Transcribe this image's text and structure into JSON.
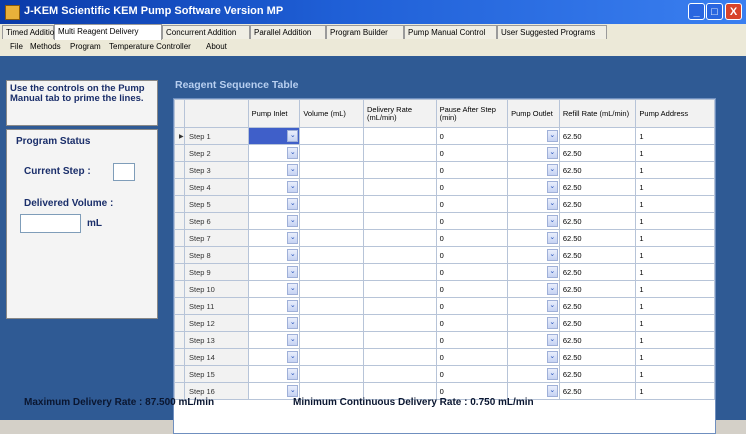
{
  "window": {
    "title": "J-KEM Scientific KEM Pump Software   Version MP"
  },
  "tabs": [
    {
      "label": "Timed Addition"
    },
    {
      "label": "Multi Reagent Delivery"
    },
    {
      "label": "Concurrent Addition"
    },
    {
      "label": "Parallel Addition"
    },
    {
      "label": "Program Builder"
    },
    {
      "label": "Pump Manual Control"
    },
    {
      "label": "User Suggested Programs"
    }
  ],
  "menu": [
    "File",
    "Methods",
    "Program",
    "Temperature Controller",
    "About"
  ],
  "note": "Use the controls on the Pump Manual tab to prime the lines.",
  "status": {
    "title": "Program Status",
    "current_step_label": "Current Step :",
    "current_step_value": "",
    "delivered_volume_label": "Delivered Volume :",
    "delivered_volume_value": "",
    "delivered_volume_unit": "mL"
  },
  "grid": {
    "title": "Reagent Sequence Table",
    "columns": [
      "",
      "",
      "Pump Inlet",
      "Volume (mL)",
      "Delivery Rate (mL/min)",
      "Pause After Step (min)",
      "Pump Outlet",
      "Refill Rate (mL/min)",
      "Pump Address"
    ],
    "rows": [
      {
        "step": "Step 1",
        "inlet": "",
        "volume": "",
        "rate": "",
        "pause": "0",
        "outlet": "",
        "refill": "62.50",
        "address": "1"
      },
      {
        "step": "Step 2",
        "inlet": "",
        "volume": "",
        "rate": "",
        "pause": "0",
        "outlet": "",
        "refill": "62.50",
        "address": "1"
      },
      {
        "step": "Step 3",
        "inlet": "",
        "volume": "",
        "rate": "",
        "pause": "0",
        "outlet": "",
        "refill": "62.50",
        "address": "1"
      },
      {
        "step": "Step 4",
        "inlet": "",
        "volume": "",
        "rate": "",
        "pause": "0",
        "outlet": "",
        "refill": "62.50",
        "address": "1"
      },
      {
        "step": "Step 5",
        "inlet": "",
        "volume": "",
        "rate": "",
        "pause": "0",
        "outlet": "",
        "refill": "62.50",
        "address": "1"
      },
      {
        "step": "Step 6",
        "inlet": "",
        "volume": "",
        "rate": "",
        "pause": "0",
        "outlet": "",
        "refill": "62.50",
        "address": "1"
      },
      {
        "step": "Step 7",
        "inlet": "",
        "volume": "",
        "rate": "",
        "pause": "0",
        "outlet": "",
        "refill": "62.50",
        "address": "1"
      },
      {
        "step": "Step 8",
        "inlet": "",
        "volume": "",
        "rate": "",
        "pause": "0",
        "outlet": "",
        "refill": "62.50",
        "address": "1"
      },
      {
        "step": "Step 9",
        "inlet": "",
        "volume": "",
        "rate": "",
        "pause": "0",
        "outlet": "",
        "refill": "62.50",
        "address": "1"
      },
      {
        "step": "Step 10",
        "inlet": "",
        "volume": "",
        "rate": "",
        "pause": "0",
        "outlet": "",
        "refill": "62.50",
        "address": "1"
      },
      {
        "step": "Step 11",
        "inlet": "",
        "volume": "",
        "rate": "",
        "pause": "0",
        "outlet": "",
        "refill": "62.50",
        "address": "1"
      },
      {
        "step": "Step 12",
        "inlet": "",
        "volume": "",
        "rate": "",
        "pause": "0",
        "outlet": "",
        "refill": "62.50",
        "address": "1"
      },
      {
        "step": "Step 13",
        "inlet": "",
        "volume": "",
        "rate": "",
        "pause": "0",
        "outlet": "",
        "refill": "62.50",
        "address": "1"
      },
      {
        "step": "Step 14",
        "inlet": "",
        "volume": "",
        "rate": "",
        "pause": "0",
        "outlet": "",
        "refill": "62.50",
        "address": "1"
      },
      {
        "step": "Step 15",
        "inlet": "",
        "volume": "",
        "rate": "",
        "pause": "0",
        "outlet": "",
        "refill": "62.50",
        "address": "1"
      },
      {
        "step": "Step 16",
        "inlet": "",
        "volume": "",
        "rate": "",
        "pause": "0",
        "outlet": "",
        "refill": "62.50",
        "address": "1"
      }
    ]
  },
  "footer": {
    "max_rate": "Maximum Delivery Rate : 87.500 mL/min",
    "min_rate": "Minimum Continuous Delivery Rate : 0.750 mL/min"
  },
  "icons": {
    "app": "app-icon",
    "combo": "chevron-down-icon",
    "row_pointer": "row-pointer-icon"
  },
  "colors": {
    "content_bg": "#2f5a94",
    "title_bar": "#1f5fd6",
    "selected_cell": "#3f5fc9"
  }
}
